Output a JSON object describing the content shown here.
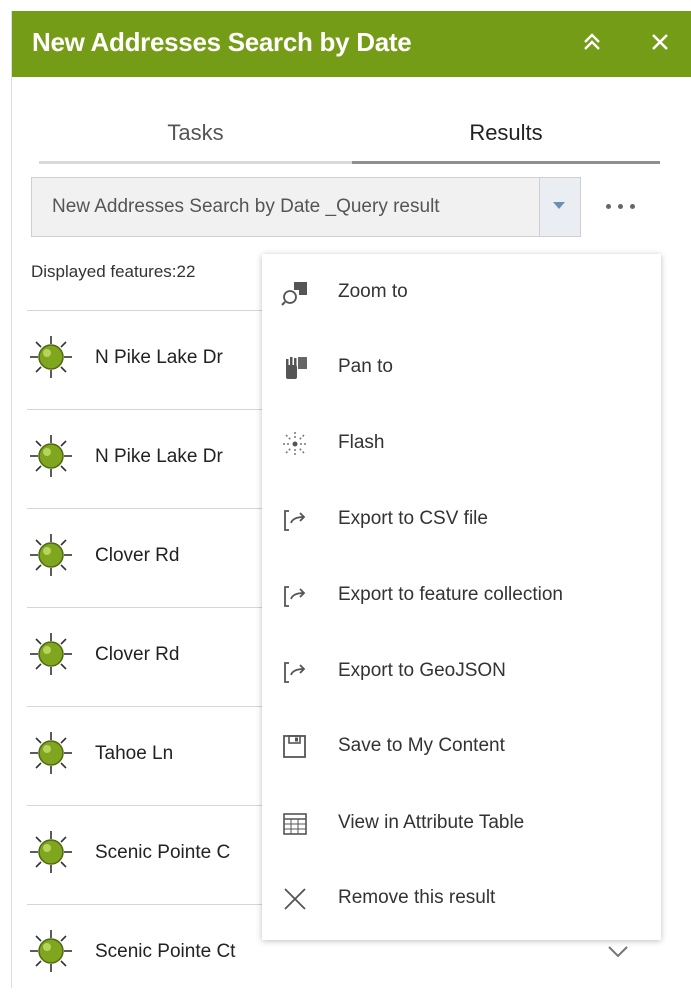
{
  "panel": {
    "title": "New Addresses Search by Date",
    "accent_color": "#749c16",
    "header_icons": [
      "collapse-up-icon",
      "close-icon"
    ]
  },
  "tabs": [
    {
      "label": "Tasks",
      "selected": false
    },
    {
      "label": "Results",
      "selected": true
    }
  ],
  "result_select": {
    "value": "New Addresses Search by Date _Query result"
  },
  "displayed_features": "Displayed features:22",
  "results": [
    {
      "label": "N Pike Lake Dr"
    },
    {
      "label": "N Pike Lake Dr"
    },
    {
      "label": "Clover Rd"
    },
    {
      "label": "Clover Rd"
    },
    {
      "label": "Tahoe Ln"
    },
    {
      "label": "Scenic Pointe C"
    },
    {
      "label": "Scenic Pointe Ct"
    }
  ],
  "context_menu": {
    "items": [
      {
        "label": "Zoom to",
        "icon": "zoom-to-icon"
      },
      {
        "label": "Pan to",
        "icon": "pan-to-icon"
      },
      {
        "label": "Flash",
        "icon": "flash-icon"
      },
      {
        "label": "Export to CSV file",
        "icon": "export-icon"
      },
      {
        "label": "Export to feature collection",
        "icon": "export-icon"
      },
      {
        "label": "Export to GeoJSON",
        "icon": "export-icon"
      },
      {
        "label": "Save to My Content",
        "icon": "save-icon"
      },
      {
        "label": "View in Attribute Table",
        "icon": "table-icon"
      },
      {
        "label": "Remove this result",
        "icon": "close-icon"
      }
    ]
  }
}
